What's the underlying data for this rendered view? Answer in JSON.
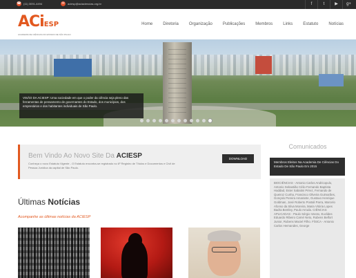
{
  "topbar": {
    "phone": "(11) 3091-4494",
    "email": "aciesp@aciaciencias.org.br",
    "social": [
      {
        "icon": "facebook-icon",
        "glyph": "f"
      },
      {
        "icon": "twitter-icon",
        "glyph": "t"
      },
      {
        "icon": "youtube-icon",
        "glyph": "▶"
      },
      {
        "icon": "googleplus-icon",
        "glyph": "g+"
      }
    ]
  },
  "header": {
    "logo_mark": "ACi",
    "logo_sub": "ESP",
    "logo_tagline": "ACADEMIA DE CIÊNCIAS DO ESTADO DE SÃO PAULO",
    "nav": [
      "Home",
      "Diretoria",
      "Organização",
      "Publicações",
      "Membros",
      "Links",
      "Estatuto",
      "Notícias"
    ]
  },
  "hero": {
    "caption": "VISÃO DA ACIESP: Uma sociedade em que o poder da ciência seja pleno das ferramentas de pensamento de governantes do Estado, dos municípios, dos empresários e dos habitantes individuais de São Paulo.",
    "slide_count": 12,
    "active_slide": 11
  },
  "welcome": {
    "title_prefix": "Bem Vindo Ao Novo Site Da",
    "title_brand": "ACIESP",
    "text": "Conheça o novo Estatuto Vigente - O Estatuto encontra-se registrado no 6º Registro de Títulos e Documentos e Civil de Pessoa Jurídica da capital de São Paulo.",
    "download_label": "DOWNLOAD"
  },
  "news": {
    "title_light": "Últimas",
    "title_bold": "Notícias",
    "subtitle": "Acompanhe as últimas notícias da ACIESP"
  },
  "sidebar": {
    "title": "Comunicados",
    "headline": "Membros Eleitos Na Academia De Ciências Do Estado De São Paulo Em 2015",
    "body": "BIOCIÊNCIAS - Antonio Carlos Andricopulo, Antonio Sebastião Célio Fernando Baptista Haddad, Ester Sabatini Pérez, Fernando de Queiroz Cunha, Francisco Oliveira Guimarães, Gonçalo Pereira Amarante, Gustavo Henrique Goldman, José Roberto Postali Parra, Marcelo Afonso da Silva Moreira, Maria Vitória Lopes Badra Bentley, Paulo Arruda. CIÊNCIAS APLICADAS - Paulo Sérgio Varoto, Euclides Eduardo Ribeiro Carné Neto, Rubens Belfort Junior, Rubens Maciel Filho. FÍSICA - Antonio Carlos Hernandes, George"
  }
}
